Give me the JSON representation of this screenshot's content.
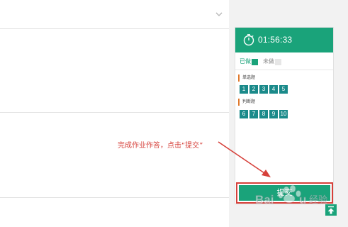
{
  "timer": {
    "value": "01:56:33",
    "icon": "stopwatch-icon"
  },
  "legend": {
    "done_label": "已做",
    "todo_label": "未做"
  },
  "sections": [
    {
      "title": "单选题",
      "questions": [
        "1",
        "2",
        "3",
        "4",
        "5"
      ]
    },
    {
      "title": "判断题",
      "questions": [
        "6",
        "7",
        "8",
        "9",
        "10"
      ]
    }
  ],
  "annotation": {
    "text": "完成作业作答，点击“提交”"
  },
  "submit": {
    "label": "提交"
  },
  "watermark": {
    "text": "Baidu 经验"
  },
  "colors": {
    "accent": "#1aa37a",
    "question_box": "#1a8a8a",
    "annotation": "#d6403a",
    "section_marker": "#e07a2e"
  },
  "icons": {
    "dropdown": "chevron-down-icon",
    "back_to_top": "arrow-up-icon"
  }
}
